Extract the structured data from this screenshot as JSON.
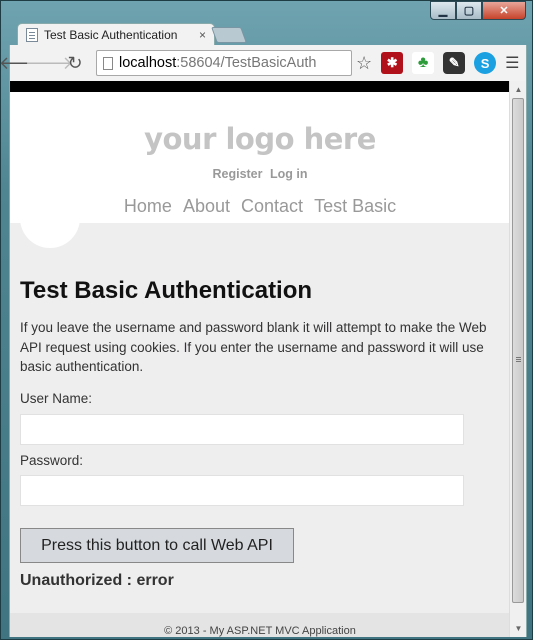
{
  "tab": {
    "title": "Test Basic Authentication",
    "close": "×"
  },
  "toolbar": {
    "url_host": "localhost",
    "url_rest": ":58604/TestBasicAuth"
  },
  "header": {
    "logo": "your logo here",
    "auth_links": [
      "Register",
      "Log in"
    ],
    "nav": [
      "Home",
      "About",
      "Contact",
      "Test Basic"
    ]
  },
  "main": {
    "heading": "Test Basic Authentication",
    "description": "If you leave the username and password blank it will attempt to make the Web API request using cookies. If you enter the username and password it will use basic authentication.",
    "username_label": "User Name:",
    "username_value": "",
    "password_label": "Password:",
    "password_value": "",
    "button_label": "Press this button to call Web API",
    "result": "Unauthorized : error"
  },
  "footer": {
    "text": "© 2013 - My ASP.NET MVC Application"
  }
}
